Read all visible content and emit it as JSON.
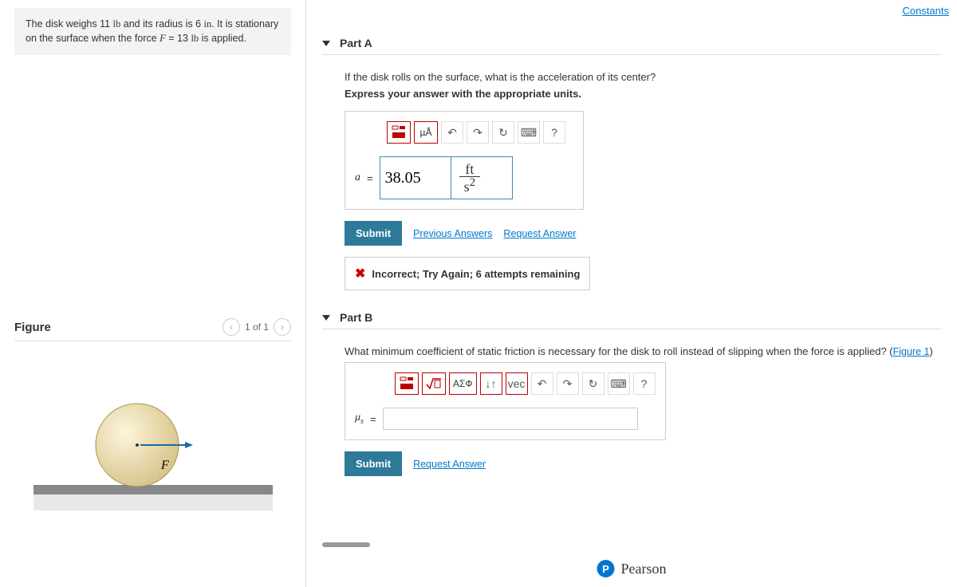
{
  "constants_link": "Constants",
  "problem": {
    "text_1": "The disk weighs 11 ",
    "text_2": " and its radius is 6 ",
    "text_3": ". It is stationary on the surface when the force ",
    "text_4": " = 13 ",
    "text_5": " is applied.",
    "lb": "lb",
    "in": "in",
    "F": "F"
  },
  "figure": {
    "title": "Figure",
    "pager": "1 of 1",
    "force_label": "F"
  },
  "partA": {
    "title": "Part A",
    "prompt": "If the disk rolls on the surface, what is the acceleration of its center?",
    "instruct": "Express your answer with the appropriate units.",
    "toolbar": {
      "templates": "",
      "units": "µÅ",
      "undo": "↶",
      "redo": "↷",
      "reset": "↻",
      "keyboard": "⌨",
      "help": "?"
    },
    "var": "a",
    "eq": "=",
    "value": "38.05",
    "unit_num": "ft",
    "unit_den": "s",
    "unit_exp": "2",
    "submit": "Submit",
    "prev": "Previous Answers",
    "req": "Request Answer",
    "feedback": "Incorrect; Try Again; 6 attempts remaining"
  },
  "partB": {
    "title": "Part B",
    "prompt_1": "What minimum coefficient of static friction is necessary for the disk to roll instead of slipping when the force is applied? (",
    "fig_link": "Figure 1",
    "prompt_2": ")",
    "toolbar": {
      "templates": "",
      "sqrt": "",
      "greek": "ΑΣФ",
      "arrows": "↓↑",
      "vec": "vec",
      "undo": "↶",
      "redo": "↷",
      "reset": "↻",
      "keyboard": "⌨",
      "help": "?"
    },
    "var": "μ",
    "sub": "s",
    "eq": "=",
    "value": "",
    "submit": "Submit",
    "req": "Request Answer"
  },
  "footer": "Pearson"
}
